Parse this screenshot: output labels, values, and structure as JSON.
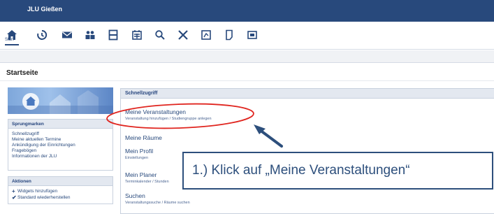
{
  "header": {
    "title": "JLU Gießen"
  },
  "nav": {
    "items": [
      {
        "name": "start-icon"
      },
      {
        "name": "history-icon"
      },
      {
        "name": "mail-icon"
      },
      {
        "name": "community-icon"
      },
      {
        "name": "schedule-icon"
      },
      {
        "name": "calendar-icon"
      },
      {
        "name": "search-icon"
      },
      {
        "name": "tools-icon"
      },
      {
        "name": "admin-icon"
      },
      {
        "name": "files-icon"
      },
      {
        "name": "contents-icon"
      }
    ],
    "start_label": "Start"
  },
  "page": {
    "title": "Startseite"
  },
  "sidebar": {
    "jumpmarks": {
      "heading": "Sprungmarken",
      "links": [
        "Schnellzugriff",
        "Meine aktuellen Termine",
        "Ankündigung der Einrichtungen",
        "Fragebögen",
        "Informationen der JLU"
      ]
    },
    "actions": {
      "heading": "Aktionen",
      "items": [
        {
          "icon": "plus-icon",
          "label": "Widgets hinzufügen"
        },
        {
          "icon": "check-icon",
          "label": "Standard wiederherstellen"
        }
      ]
    }
  },
  "quickaccess": {
    "heading": "Schnellzugriff",
    "entries": [
      {
        "title": "Meine Veranstaltungen",
        "sub": "Veranstaltung hinzufügen / Studiengruppe anlegen"
      },
      {
        "title": "Meine Räume",
        "sub": ""
      },
      {
        "title": "Mein Profil",
        "sub": "Einstellungen"
      },
      {
        "title": "Mein Planer",
        "sub": "Terminkalender / Stunden"
      },
      {
        "title": "Suchen",
        "sub": "Veranstaltungssuche / Räume suchen"
      }
    ]
  },
  "annotation": {
    "text": "1.) Klick auf „Meine Veranstaltungen“",
    "colors": {
      "circle": "#e0251f",
      "arrow": "#2d4f7c"
    }
  }
}
